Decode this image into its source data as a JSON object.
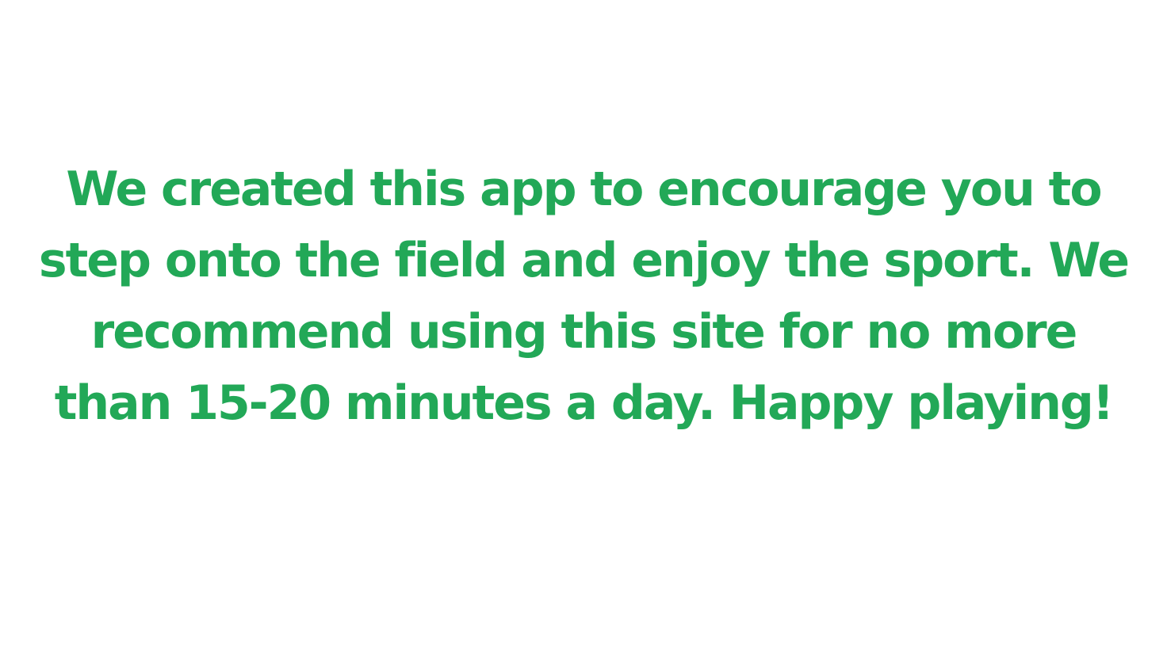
{
  "colors": {
    "background": "#ffffff",
    "text": "#22a857"
  },
  "message": {
    "lines": [
      "We created this app to encourage you to",
      "step onto the field and enjoy the sport. We",
      "recommend using this site for no more",
      "than 15-20 minutes a day. Happy playing!"
    ]
  }
}
